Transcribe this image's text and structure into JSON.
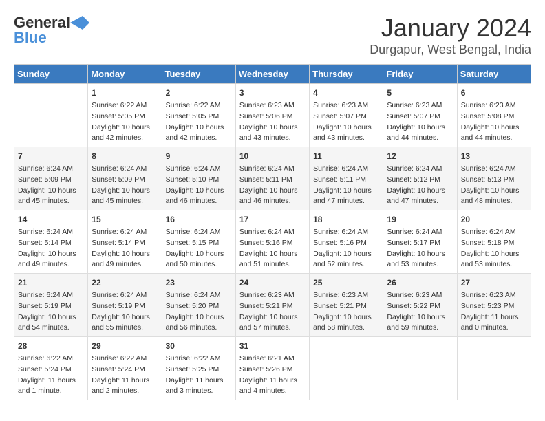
{
  "header": {
    "logo_line1": "General",
    "logo_line2": "Blue",
    "title": "January 2024",
    "subtitle": "Durgapur, West Bengal, India"
  },
  "days_of_week": [
    "Sunday",
    "Monday",
    "Tuesday",
    "Wednesday",
    "Thursday",
    "Friday",
    "Saturday"
  ],
  "weeks": [
    [
      {
        "day": "",
        "data": ""
      },
      {
        "day": "1",
        "data": "Sunrise: 6:22 AM\nSunset: 5:05 PM\nDaylight: 10 hours\nand 42 minutes."
      },
      {
        "day": "2",
        "data": "Sunrise: 6:22 AM\nSunset: 5:05 PM\nDaylight: 10 hours\nand 42 minutes."
      },
      {
        "day": "3",
        "data": "Sunrise: 6:23 AM\nSunset: 5:06 PM\nDaylight: 10 hours\nand 43 minutes."
      },
      {
        "day": "4",
        "data": "Sunrise: 6:23 AM\nSunset: 5:07 PM\nDaylight: 10 hours\nand 43 minutes."
      },
      {
        "day": "5",
        "data": "Sunrise: 6:23 AM\nSunset: 5:07 PM\nDaylight: 10 hours\nand 44 minutes."
      },
      {
        "day": "6",
        "data": "Sunrise: 6:23 AM\nSunset: 5:08 PM\nDaylight: 10 hours\nand 44 minutes."
      }
    ],
    [
      {
        "day": "7",
        "data": "Sunrise: 6:24 AM\nSunset: 5:09 PM\nDaylight: 10 hours\nand 45 minutes."
      },
      {
        "day": "8",
        "data": "Sunrise: 6:24 AM\nSunset: 5:09 PM\nDaylight: 10 hours\nand 45 minutes."
      },
      {
        "day": "9",
        "data": "Sunrise: 6:24 AM\nSunset: 5:10 PM\nDaylight: 10 hours\nand 46 minutes."
      },
      {
        "day": "10",
        "data": "Sunrise: 6:24 AM\nSunset: 5:11 PM\nDaylight: 10 hours\nand 46 minutes."
      },
      {
        "day": "11",
        "data": "Sunrise: 6:24 AM\nSunset: 5:11 PM\nDaylight: 10 hours\nand 47 minutes."
      },
      {
        "day": "12",
        "data": "Sunrise: 6:24 AM\nSunset: 5:12 PM\nDaylight: 10 hours\nand 47 minutes."
      },
      {
        "day": "13",
        "data": "Sunrise: 6:24 AM\nSunset: 5:13 PM\nDaylight: 10 hours\nand 48 minutes."
      }
    ],
    [
      {
        "day": "14",
        "data": "Sunrise: 6:24 AM\nSunset: 5:14 PM\nDaylight: 10 hours\nand 49 minutes."
      },
      {
        "day": "15",
        "data": "Sunrise: 6:24 AM\nSunset: 5:14 PM\nDaylight: 10 hours\nand 49 minutes."
      },
      {
        "day": "16",
        "data": "Sunrise: 6:24 AM\nSunset: 5:15 PM\nDaylight: 10 hours\nand 50 minutes."
      },
      {
        "day": "17",
        "data": "Sunrise: 6:24 AM\nSunset: 5:16 PM\nDaylight: 10 hours\nand 51 minutes."
      },
      {
        "day": "18",
        "data": "Sunrise: 6:24 AM\nSunset: 5:16 PM\nDaylight: 10 hours\nand 52 minutes."
      },
      {
        "day": "19",
        "data": "Sunrise: 6:24 AM\nSunset: 5:17 PM\nDaylight: 10 hours\nand 53 minutes."
      },
      {
        "day": "20",
        "data": "Sunrise: 6:24 AM\nSunset: 5:18 PM\nDaylight: 10 hours\nand 53 minutes."
      }
    ],
    [
      {
        "day": "21",
        "data": "Sunrise: 6:24 AM\nSunset: 5:19 PM\nDaylight: 10 hours\nand 54 minutes."
      },
      {
        "day": "22",
        "data": "Sunrise: 6:24 AM\nSunset: 5:19 PM\nDaylight: 10 hours\nand 55 minutes."
      },
      {
        "day": "23",
        "data": "Sunrise: 6:24 AM\nSunset: 5:20 PM\nDaylight: 10 hours\nand 56 minutes."
      },
      {
        "day": "24",
        "data": "Sunrise: 6:23 AM\nSunset: 5:21 PM\nDaylight: 10 hours\nand 57 minutes."
      },
      {
        "day": "25",
        "data": "Sunrise: 6:23 AM\nSunset: 5:21 PM\nDaylight: 10 hours\nand 58 minutes."
      },
      {
        "day": "26",
        "data": "Sunrise: 6:23 AM\nSunset: 5:22 PM\nDaylight: 10 hours\nand 59 minutes."
      },
      {
        "day": "27",
        "data": "Sunrise: 6:23 AM\nSunset: 5:23 PM\nDaylight: 11 hours\nand 0 minutes."
      }
    ],
    [
      {
        "day": "28",
        "data": "Sunrise: 6:22 AM\nSunset: 5:24 PM\nDaylight: 11 hours\nand 1 minute."
      },
      {
        "day": "29",
        "data": "Sunrise: 6:22 AM\nSunset: 5:24 PM\nDaylight: 11 hours\nand 2 minutes."
      },
      {
        "day": "30",
        "data": "Sunrise: 6:22 AM\nSunset: 5:25 PM\nDaylight: 11 hours\nand 3 minutes."
      },
      {
        "day": "31",
        "data": "Sunrise: 6:21 AM\nSunset: 5:26 PM\nDaylight: 11 hours\nand 4 minutes."
      },
      {
        "day": "",
        "data": ""
      },
      {
        "day": "",
        "data": ""
      },
      {
        "day": "",
        "data": ""
      }
    ]
  ]
}
